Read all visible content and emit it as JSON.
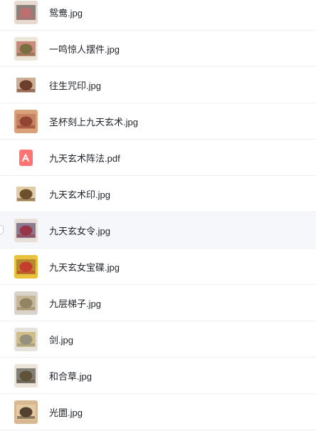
{
  "files": [
    {
      "name": "鸳鸯.jpg",
      "type": "image",
      "icon": "image-thumbnail",
      "thumb_colors": [
        "#e7d9cf",
        "#c76b6b",
        "#3a3a3a"
      ]
    },
    {
      "name": "一鸣惊人摆件.jpg",
      "type": "image",
      "icon": "image-thumbnail",
      "thumb_colors": [
        "#ece6d8",
        "#6b6b3a",
        "#b33a2a"
      ]
    },
    {
      "name": "往生咒印.jpg",
      "type": "image",
      "icon": "image-thumbnail",
      "thumb_colors": [
        "#ffffff",
        "#5a2a1a",
        "#a86a3a"
      ]
    },
    {
      "name": "圣杯刻上九天玄术.jpg",
      "type": "image",
      "icon": "image-thumbnail",
      "thumb_colors": [
        "#d9a27a",
        "#8a3a2a",
        "#b86a4a"
      ]
    },
    {
      "name": "九天玄术阵法.pdf",
      "type": "pdf",
      "icon": "pdf-icon",
      "thumb_colors": [
        "#ff7373",
        "#ffffff",
        "#ffffff"
      ]
    },
    {
      "name": "九天玄术印.jpg",
      "type": "image",
      "icon": "image-thumbnail",
      "thumb_colors": [
        "#ffffff",
        "#5a3a1a",
        "#c8a35a"
      ]
    },
    {
      "name": "九天玄女令.jpg",
      "type": "image",
      "icon": "image-thumbnail",
      "thumb_colors": [
        "#e8e0d8",
        "#9a2a3a",
        "#3a2a5a"
      ]
    },
    {
      "name": "九天玄女宝碟.jpg",
      "type": "image",
      "icon": "image-thumbnail",
      "thumb_colors": [
        "#e8c23a",
        "#c8302a",
        "#8a5a2a"
      ]
    },
    {
      "name": "九层梯子.jpg",
      "type": "image",
      "icon": "image-thumbnail",
      "thumb_colors": [
        "#d8d4cc",
        "#8a7a5a",
        "#b8a06a"
      ]
    },
    {
      "name": "剑.jpg",
      "type": "image",
      "icon": "image-thumbnail",
      "thumb_colors": [
        "#e6e2dc",
        "#8a8a7a",
        "#c0a040"
      ]
    },
    {
      "name": "和合草.jpg",
      "type": "image",
      "icon": "image-thumbnail",
      "thumb_colors": [
        "#ece4d8",
        "#5a4a2a",
        "#2a2a2a"
      ]
    },
    {
      "name": "光圜.jpg",
      "type": "image",
      "icon": "image-thumbnail",
      "thumb_colors": [
        "#d8b890",
        "#3a2a1a",
        "#f0d8b0"
      ]
    }
  ],
  "hovered_index": 6
}
